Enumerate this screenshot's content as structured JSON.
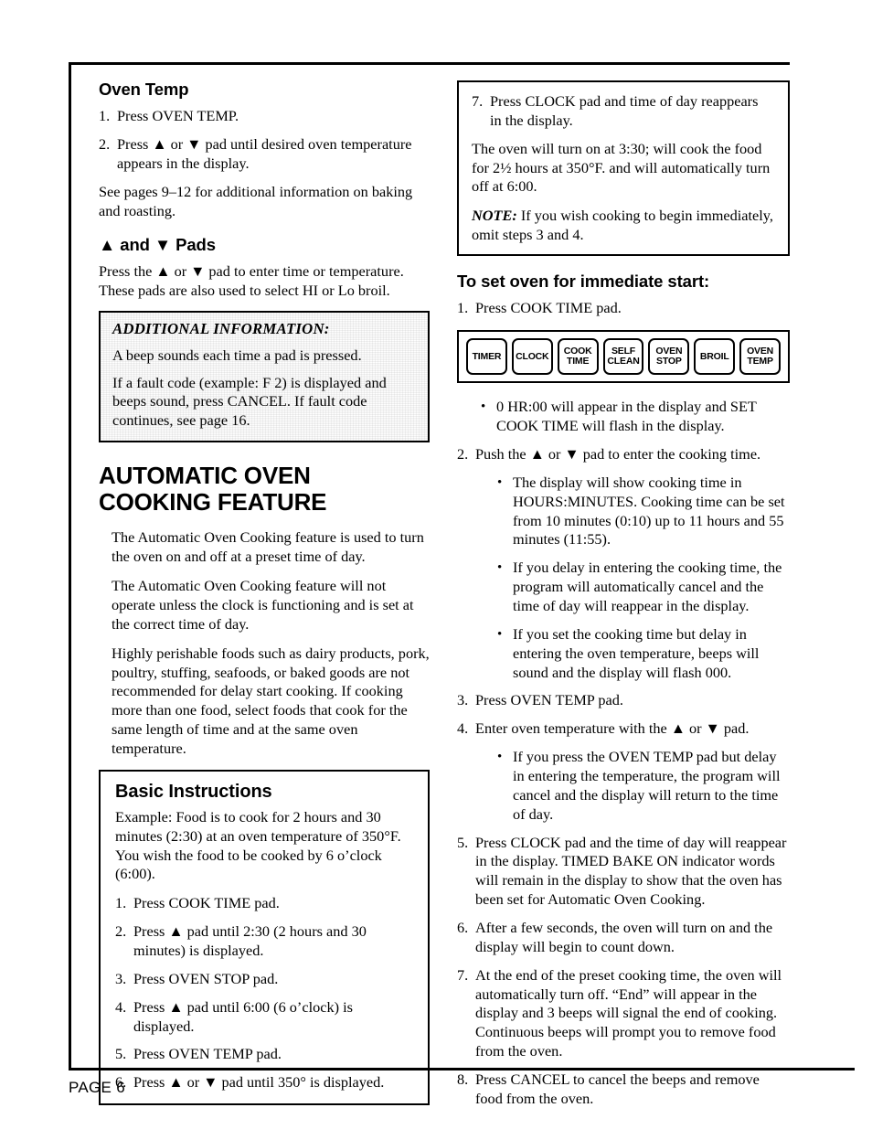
{
  "page": {
    "footer_label": "PAGE 6"
  },
  "left_column": {
    "oven_temp": {
      "heading": "Oven Temp",
      "steps": [
        {
          "marker": "1.",
          "text": "Press OVEN TEMP."
        },
        {
          "marker": "2.",
          "text": "Press ▲ or ▼ pad until desired oven temperature appears in the display."
        }
      ],
      "note": "See pages 9–12 for additional information on baking and roasting."
    },
    "arrow_pads": {
      "heading": "▲ and ▼ Pads",
      "body": "Press the ▲ or ▼ pad to enter time or temperature. These pads are also used to select HI or Lo broil."
    },
    "additional_information": {
      "title": "ADDITIONAL INFORMATION:",
      "paragraphs": [
        "A beep sounds each time a pad is pressed.",
        "If a fault code (example: F 2) is displayed and beeps sound, press CANCEL. If fault code continues, see page 16."
      ]
    },
    "automatic_oven": {
      "heading_line1": "AUTOMATIC OVEN",
      "heading_line2": "COOKING FEATURE",
      "paragraphs": [
        "The Automatic Oven Cooking feature is used to turn the oven on and off at a preset time of day.",
        "The Automatic Oven Cooking feature will not operate unless the clock is functioning and is set at the correct time of day.",
        "Highly perishable foods such as dairy products, pork, poultry, stuffing, seafoods, or baked goods are not recommended for delay start cooking. If cooking more than one food, select foods that cook for the same length of time and at the same oven temperature."
      ]
    },
    "basic_instructions": {
      "heading": "Basic Instructions",
      "example": "Example: Food is to cook for 2 hours and 30 minutes (2:30) at an oven temperature of 350°F. You wish the food to be cooked by 6 o’clock (6:00).",
      "steps": [
        {
          "marker": "1.",
          "text": "Press COOK TIME pad."
        },
        {
          "marker": "2.",
          "text": "Press ▲ pad until 2:30 (2 hours and 30 minutes) is displayed."
        },
        {
          "marker": "3.",
          "text": "Press OVEN STOP pad."
        },
        {
          "marker": "4.",
          "text": "Press ▲ pad until 6:00 (6 o’clock) is displayed."
        },
        {
          "marker": "5.",
          "text": "Press OVEN TEMP pad."
        },
        {
          "marker": "6.",
          "text": "Press ▲ or ▼ pad until 350° is displayed."
        }
      ]
    }
  },
  "right_column": {
    "note_box": {
      "step": {
        "marker": "7.",
        "text": "Press CLOCK pad and time of day reappears in the display."
      },
      "paragraph": "The oven will turn on at 3:30; will cook the food for 2½ hours at 350°F. and will automatically turn off at 6:00.",
      "note_label": "NOTE:",
      "note_text": " If you wish cooking to begin immediately, omit steps 3 and 4."
    },
    "immediate_start": {
      "heading": "To set oven for immediate start:",
      "step1": {
        "marker": "1.",
        "text": "Press COOK TIME pad."
      }
    },
    "control_panel": {
      "pads": [
        {
          "label": "TIMER",
          "name": "timer-pad"
        },
        {
          "label": "CLOCK",
          "name": "clock-pad"
        },
        {
          "label": "COOK\nTIME",
          "name": "cook-time-pad"
        },
        {
          "label": "SELF\nCLEAN",
          "name": "self-clean-pad"
        },
        {
          "label": "OVEN\nSTOP",
          "name": "oven-stop-pad"
        },
        {
          "label": "BROIL",
          "name": "broil-pad"
        },
        {
          "label": "OVEN\nTEMP",
          "name": "oven-temp-pad"
        }
      ]
    },
    "steps": [
      {
        "type": "bullet",
        "marker": "•",
        "text": "0 HR:00 will appear in the display and SET COOK TIME will flash in the display."
      },
      {
        "type": "number",
        "marker": "2.",
        "text": "Push the ▲ or ▼ pad to enter the cooking time."
      },
      {
        "type": "bullet-deep",
        "marker": "•",
        "text": "The display will show cooking time in HOURS:MINUTES. Cooking time can be set from 10 minutes (0:10) up to 11 hours and 55 minutes (11:55)."
      },
      {
        "type": "bullet-deep",
        "marker": "•",
        "text": "If you delay in entering the cooking time, the program will automatically cancel and the time of day will reappear in the display."
      },
      {
        "type": "bullet-deep",
        "marker": "•",
        "text": "If you set the cooking time but delay in entering the oven temperature, beeps will sound and the display will flash 000."
      },
      {
        "type": "number",
        "marker": "3.",
        "text": "Press OVEN TEMP pad."
      },
      {
        "type": "number",
        "marker": "4.",
        "text": "Enter oven temperature with the ▲ or ▼ pad."
      },
      {
        "type": "bullet-deep",
        "marker": "•",
        "text": "If you press the OVEN TEMP pad but delay in entering the temperature, the program will cancel and the display will return to the time of day."
      },
      {
        "type": "number",
        "marker": "5.",
        "text": "Press CLOCK pad and the time of day will reappear in the display. TIMED BAKE ON indicator words will remain in the display to show that the oven has been set for Automatic Oven Cooking."
      },
      {
        "type": "number",
        "marker": "6.",
        "text": "After a few seconds, the oven will turn on and the display will begin to count down."
      },
      {
        "type": "number",
        "marker": "7.",
        "text": "At the end of the preset cooking time, the oven will automatically turn off. “End” will appear in the display and 3 beeps will signal the end of cooking. Continuous beeps will prompt you to remove food from the oven."
      },
      {
        "type": "number",
        "marker": "8.",
        "text": "Press CANCEL to cancel the beeps and remove food from the oven."
      }
    ]
  }
}
